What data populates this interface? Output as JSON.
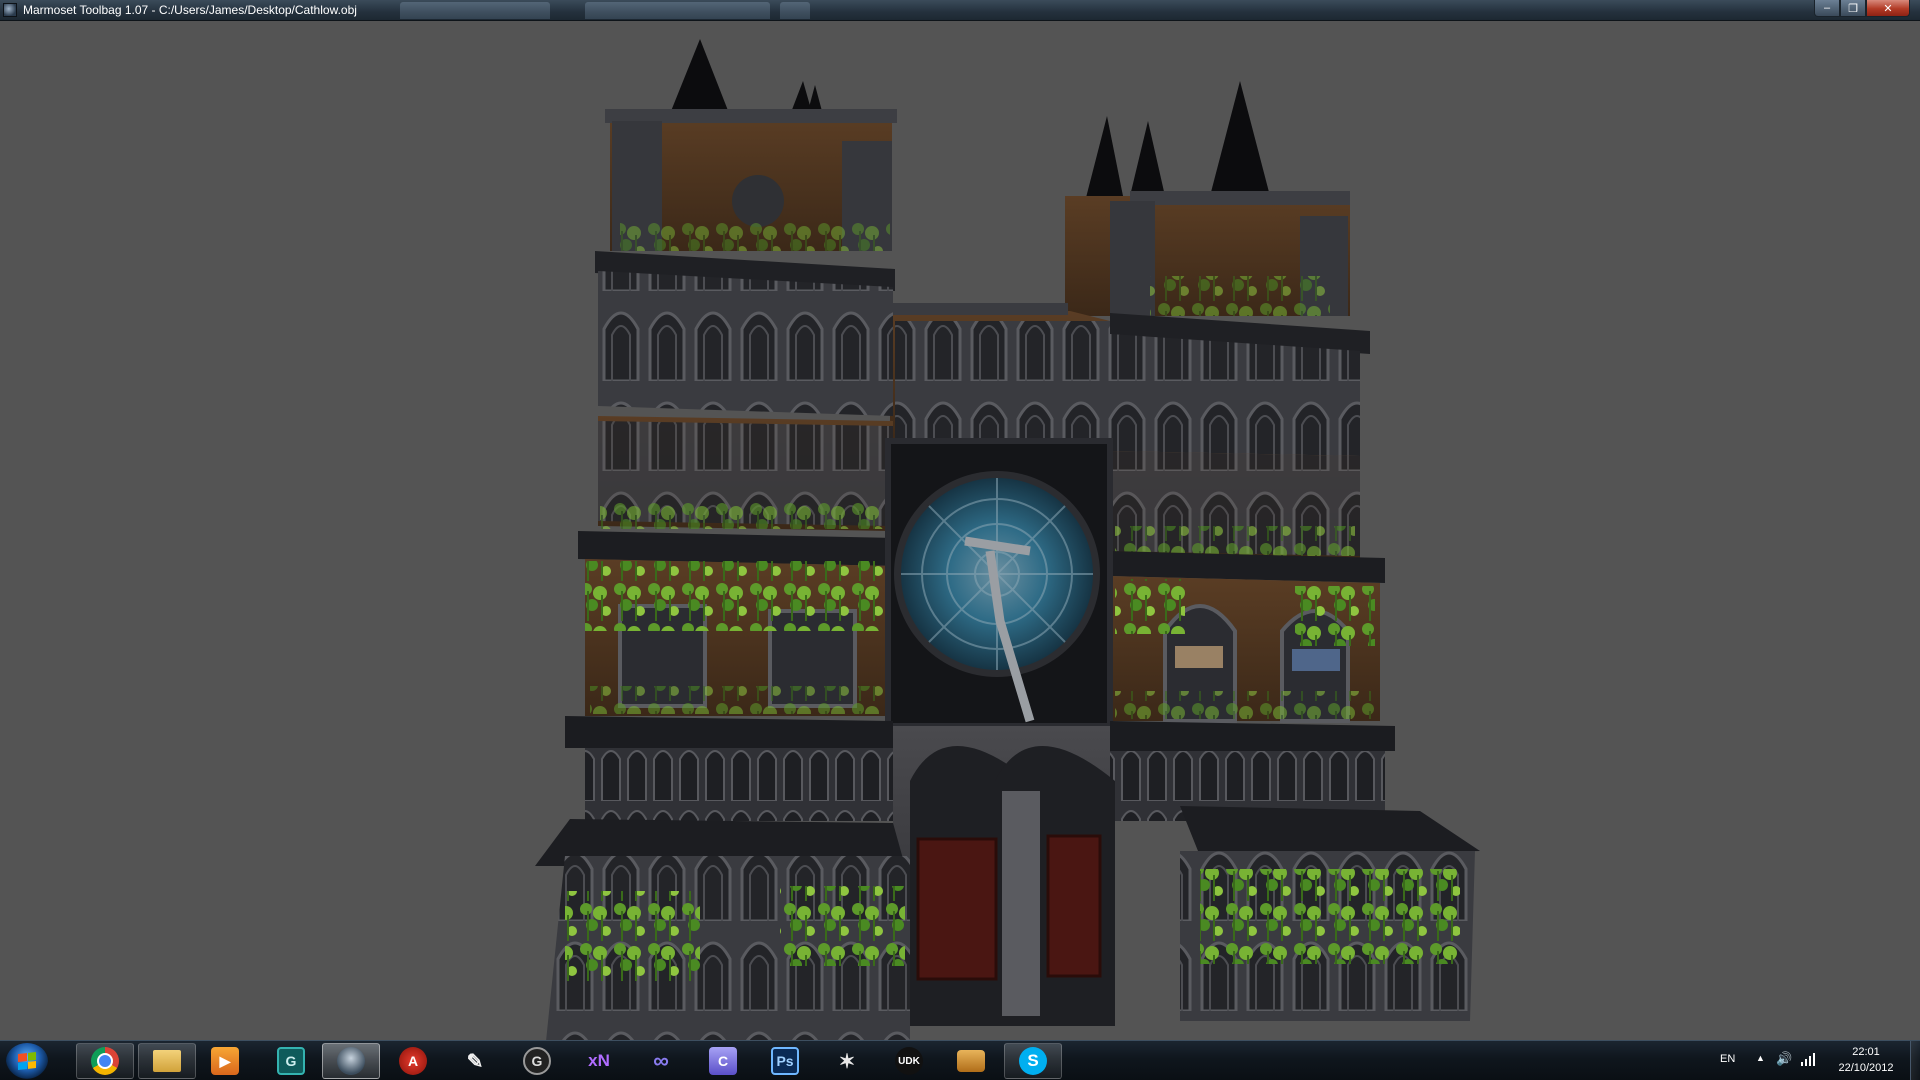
{
  "window": {
    "title": "Marmoset Toolbag 1.07 - C:/Users/James/Desktop/Cathlow.obj",
    "minimize_glyph": "–",
    "maximize_glyph": "❐",
    "close_glyph": "✕"
  },
  "viewport": {
    "background_color": "#545454",
    "model": "cathedral-facade"
  },
  "taskbar": {
    "items": [
      {
        "name": "chrome",
        "icon": "chrome-icon"
      },
      {
        "name": "explorer",
        "icon": "folder-icon"
      },
      {
        "name": "media-player",
        "icon": "play-icon"
      },
      {
        "name": "3ds-max",
        "icon": "max-icon"
      },
      {
        "name": "marmoset-toolbag",
        "icon": "marmoset-icon",
        "active": true
      },
      {
        "name": "acrobat",
        "icon": "acrobat-icon"
      },
      {
        "name": "paint-tool",
        "icon": "brush-icon"
      },
      {
        "name": "3ds-max-2",
        "icon": "max-icon"
      },
      {
        "name": "xnormal",
        "icon": "xnormal-icon",
        "label": "xN"
      },
      {
        "name": "pipeline-tool",
        "icon": "infinity-icon"
      },
      {
        "name": "crazybump",
        "icon": "crazybump-icon"
      },
      {
        "name": "photoshop",
        "icon": "photoshop-icon",
        "label": "Ps"
      },
      {
        "name": "zbrush",
        "icon": "zbrush-icon"
      },
      {
        "name": "udk",
        "icon": "udk-icon",
        "label": "UDK"
      },
      {
        "name": "archive",
        "icon": "archive-icon"
      },
      {
        "name": "skype",
        "icon": "skype-icon",
        "label": "S"
      }
    ],
    "tray": {
      "language": "EN",
      "arrow": "▲",
      "volume": "🔊",
      "time": "22:01",
      "date": "22/10/2012"
    }
  }
}
